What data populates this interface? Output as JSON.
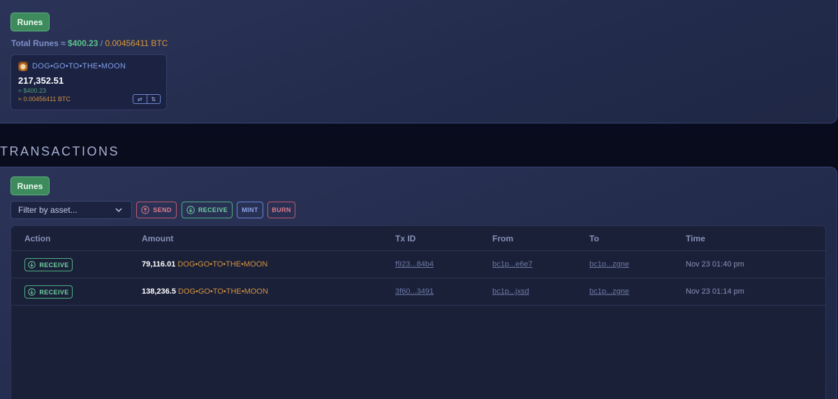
{
  "portfolio": {
    "runes_label": "Runes",
    "total_label": "Total Runes ≈",
    "total_usd": "$400.23",
    "separator": "/",
    "total_btc": "0.00456411 BTC",
    "asset": {
      "name": "DOG•GO•TO•THE•MOON",
      "amount": "217,352.51",
      "usd": "≈ $400.23",
      "btc": "≈ 0.00456411 BTC",
      "swap_icon": "⇄",
      "transfer_icon": "⇅"
    }
  },
  "transactions": {
    "title": "TRANSACTIONS",
    "runes_label": "Runes",
    "filter_placeholder": "Filter by asset...",
    "filters": {
      "send": "SEND",
      "receive": "RECEIVE",
      "mint": "MINT",
      "burn": "BURN"
    },
    "columns": {
      "action": "Action",
      "amount": "Amount",
      "txid": "Tx ID",
      "from": "From",
      "to": "To",
      "time": "Time"
    },
    "rows": [
      {
        "action": "RECEIVE",
        "amount": "79,116.01",
        "asset": "DOG•GO•TO•THE•MOON",
        "txid": "f923...84b4",
        "from": "bc1p...e6e7",
        "to": "bc1p...zgne",
        "time": "Nov 23 01:40 pm"
      },
      {
        "action": "RECEIVE",
        "amount": "138,236.5",
        "asset": "DOG•GO•TO•THE•MOON",
        "txid": "3f60...3491",
        "from": "bc1p...jxsd",
        "to": "bc1p...zgne",
        "time": "Nov 23 01:14 pm"
      }
    ]
  },
  "colors": {
    "accent_green": "#3d8a5c",
    "usd_green": "#5bc48a",
    "btc_orange": "#d8983b",
    "send_red": "#e07a8d",
    "mint_blue": "#8fa6ef",
    "background": "#0a0e22"
  }
}
